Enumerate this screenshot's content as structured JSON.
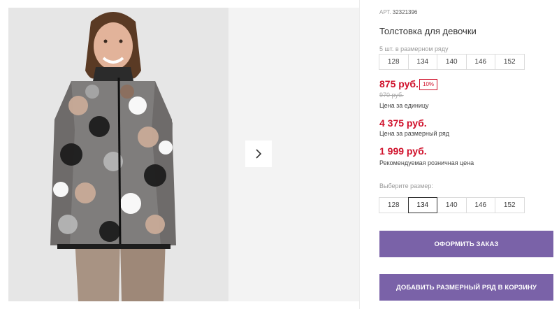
{
  "product": {
    "article_label": "АРТ.",
    "article_number": "32321396",
    "title": "Толстовка для девочки"
  },
  "pack": {
    "note": "5 шт. в размерном ряду",
    "sizes": [
      "128",
      "134",
      "140",
      "146",
      "152"
    ]
  },
  "pricing": {
    "unit_price": "875 руб.",
    "discount_badge": "10%",
    "old_price": "970 руб.",
    "unit_caption": "Цена за единицу",
    "pack_price": "4 375 руб.",
    "pack_caption": "Цена за размерный ряд",
    "retail_price": "1 999 руб.",
    "retail_caption": "Рекомендуемая розничная цена"
  },
  "size_select": {
    "label": "Выберите размер:",
    "options": [
      "128",
      "134",
      "140",
      "146",
      "152"
    ],
    "selected": "134"
  },
  "actions": {
    "order_label": "ОФОРМИТЬ ЗАКАЗ",
    "add_pack_label": "ДОБАВИТЬ РАЗМЕРНЫЙ РЯД В КОРЗИНУ"
  },
  "gallery": {
    "next_icon": "chevron-right-icon"
  },
  "colors": {
    "price_red": "#d0112b",
    "button_purple": "#7a62a8"
  }
}
